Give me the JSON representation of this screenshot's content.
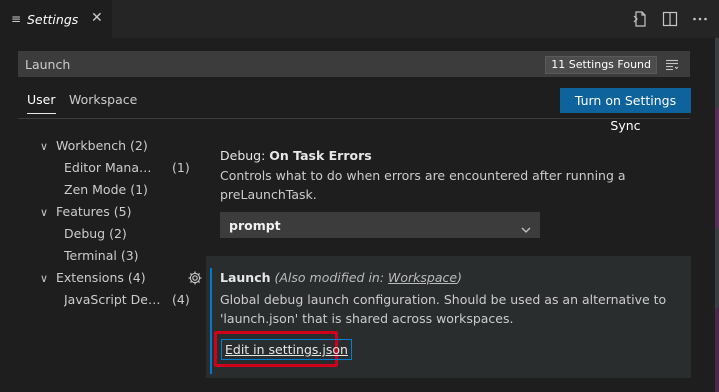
{
  "tab": {
    "title": "Settings",
    "icon": "≡",
    "close": "✕"
  },
  "search": {
    "value": "Launch",
    "count": "11 Settings Found"
  },
  "scopes": {
    "user": "User",
    "workspace": "Workspace"
  },
  "sync_button": "Turn on Settings Sync",
  "toc": [
    {
      "label": "Workbench",
      "count": "(2)",
      "chev": "∨"
    },
    {
      "label": "Editor Manage...",
      "count": "(1)"
    },
    {
      "label": "Zen Mode",
      "count": "(1)"
    },
    {
      "label": "Features",
      "count": "(5)",
      "chev": "∨"
    },
    {
      "label": "Debug",
      "count": "(2)"
    },
    {
      "label": "Terminal",
      "count": "(3)"
    },
    {
      "label": "Extensions",
      "count": "(4)",
      "chev": "∨"
    },
    {
      "label": "JavaScript Debu...",
      "count": "(4)"
    }
  ],
  "setting1": {
    "category": "Debug: ",
    "name": "On Task Errors",
    "desc1": "Controls what to do when errors are encountered after running a",
    "desc2": "preLaunchTask.",
    "value": "prompt"
  },
  "setting2": {
    "name": "Launch",
    "modified_prefix": "(Also modified in: ",
    "modified_link": "Workspace",
    "modified_suffix": ")",
    "desc1": "Global debug launch configuration. Should be used as an alternative to",
    "desc2": "'launch.json' that is shared across workspaces.",
    "edit_link": "Edit in settings.json"
  },
  "colors": {
    "accent": "#0e639c",
    "focus": "#007fd4",
    "highlight": "#d0021b"
  }
}
